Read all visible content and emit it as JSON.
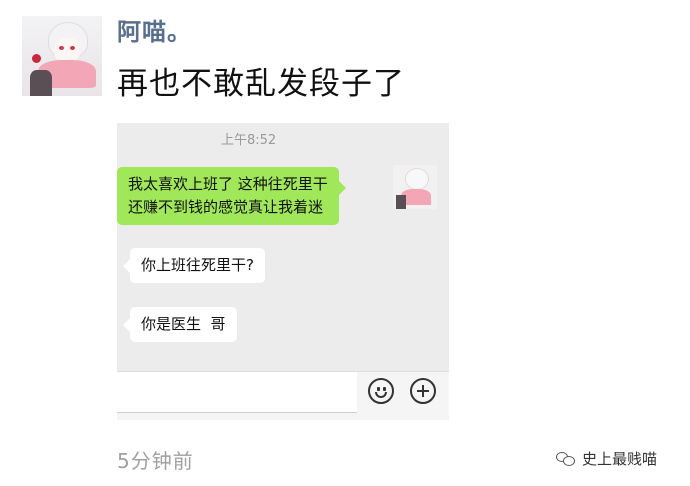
{
  "post": {
    "username": "阿喵。",
    "text": "再也不敢乱发段子了",
    "posted_ago": "5分钟前"
  },
  "screenshot": {
    "time": "上午8:52",
    "messages": [
      {
        "side": "right",
        "color": "#a0e75a",
        "text": "我太喜欢上班了 这种往死里干\n还赚不到钱的感觉真让我着迷"
      },
      {
        "side": "left",
        "color": "#ffffff",
        "text": "你上班往死里干?"
      },
      {
        "side": "left",
        "color": "#ffffff",
        "text": "你是医生  哥"
      }
    ],
    "input_placeholder": "",
    "icons": [
      "emoji-icon",
      "plus-icon"
    ]
  },
  "watermark": {
    "text": "史上最贱喵",
    "icon": "wechat-icon"
  },
  "colors": {
    "username": "#5a6f90",
    "chat_bg": "#ececec",
    "sent_bubble": "#a0e75a"
  }
}
